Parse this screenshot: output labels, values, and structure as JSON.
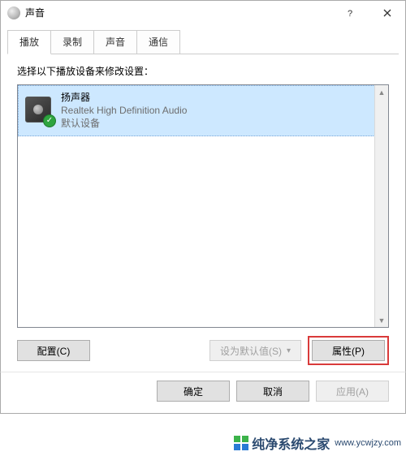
{
  "window": {
    "title": "声音"
  },
  "tabs": [
    "播放",
    "录制",
    "声音",
    "通信"
  ],
  "active_tab_index": 0,
  "instruction": "选择以下播放设备来修改设置：",
  "devices": [
    {
      "name": "扬声器",
      "driver": "Realtek High Definition Audio",
      "status": "默认设备",
      "status_icon": "check-default"
    }
  ],
  "buttons": {
    "configure": "配置(C)",
    "set_default": "设为默认值(S)",
    "properties": "属性(P)",
    "ok": "确定",
    "cancel": "取消",
    "apply": "应用(A)"
  },
  "watermark": {
    "brand": "纯净系统之家",
    "url": "www.ycwjzy.com"
  }
}
